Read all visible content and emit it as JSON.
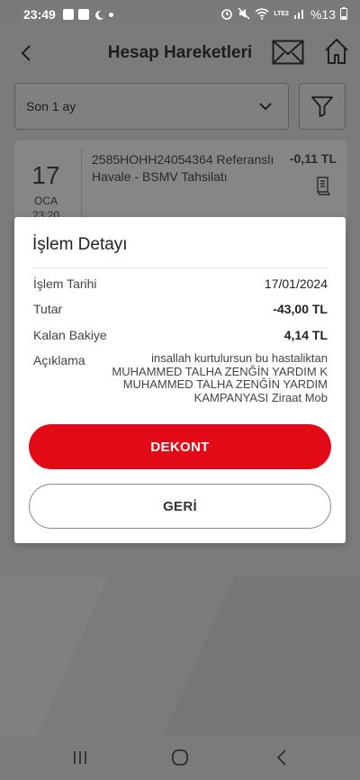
{
  "status_bar": {
    "time": "23:49",
    "battery": "%13",
    "network": "LTE2"
  },
  "header": {
    "title": "Hesap Hareketleri"
  },
  "filter": {
    "period": "Son 1 ay"
  },
  "transaction": {
    "day": "17",
    "month": "OCA",
    "time": "23:20",
    "description": "2585HOHH24054364 Referanslı Havale - BSMV Tahsilatı",
    "amount": "-0,11 TL"
  },
  "modal": {
    "title": "İşlem Detayı",
    "rows": [
      {
        "label": "İşlem Tarihi",
        "value": "17/01/2024"
      },
      {
        "label": "Tutar",
        "value": "-43,00 TL"
      },
      {
        "label": "Kalan Bakiye",
        "value": "4,14 TL"
      }
    ],
    "description_label": "Açıklama",
    "description_lines": [
      "insallah kurtulursun bu hastaliktan",
      "MUHAMMED TALHA ZENĞİN YARDIM K",
      "MUHAMMED TALHA ZENĞİN YARDIM",
      "KAMPANYASI Ziraat Mob"
    ],
    "primary_button": "DEKONT",
    "secondary_button": "GERİ"
  },
  "colors": {
    "accent": "#e30a17",
    "overlay": "#7b7b7b"
  }
}
